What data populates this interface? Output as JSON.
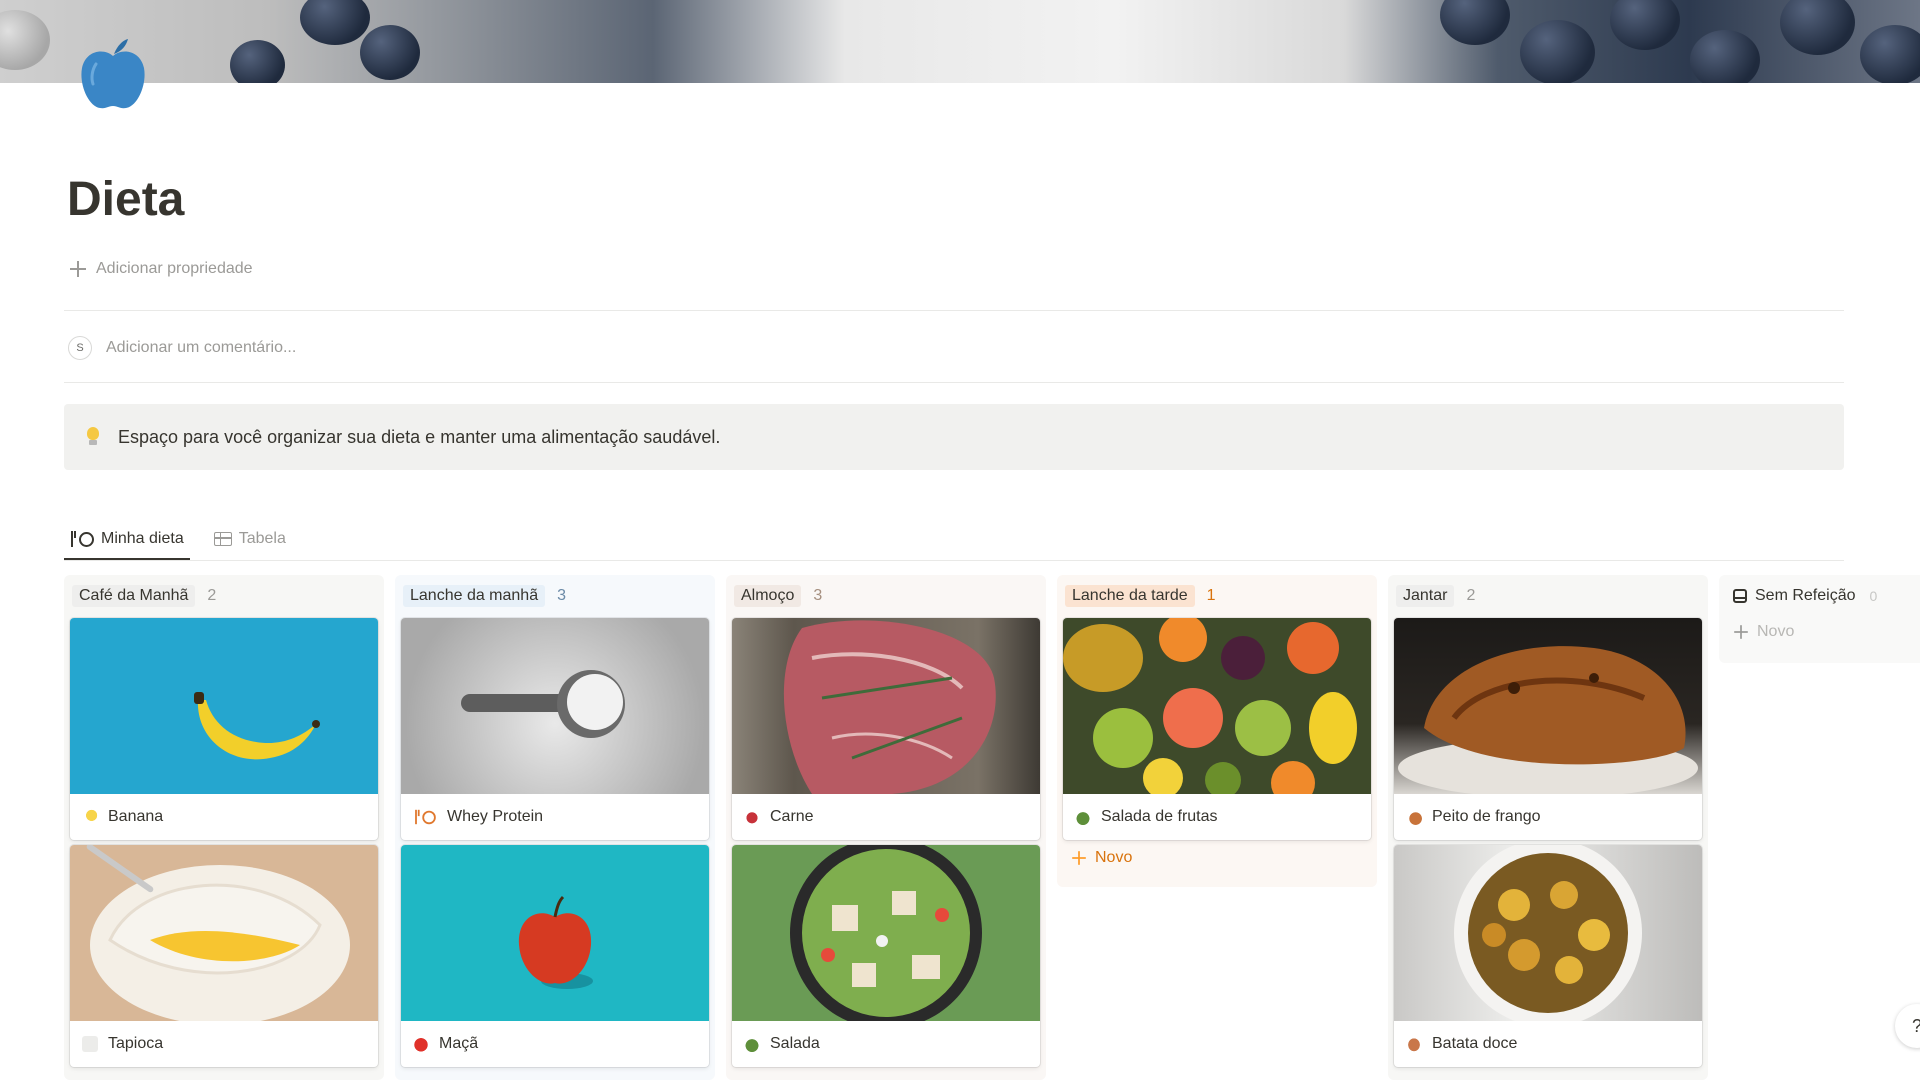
{
  "page": {
    "title": "Dieta",
    "add_property": "Adicionar propriedade",
    "comment": {
      "avatar": "S",
      "placeholder": "Adicionar um comentário..."
    },
    "callout": {
      "icon": "lightbulb-icon",
      "text": "Espaço para você organizar sua dieta e manter uma alimentação saudável."
    }
  },
  "tabs": [
    {
      "label": "Minha dieta",
      "icon": "cutlery-plate-icon",
      "active": true
    },
    {
      "label": "Tabela",
      "icon": "table-icon",
      "active": false
    }
  ],
  "columns": [
    {
      "name": "Café da Manhã",
      "count": "2",
      "pill_color": "#eeeeed",
      "bg": "#f7f7f5",
      "count_color": "#9b9a97",
      "cards": [
        {
          "title": "Banana",
          "icon": "banana-icon"
        },
        {
          "title": "Tapioca",
          "icon": "tapioca-icon"
        }
      ]
    },
    {
      "name": "Lanche da manhã",
      "count": "3",
      "pill_color": "#e7f0f8",
      "bg": "#f6f9fc",
      "count_color": "#6b8aa7",
      "cards": [
        {
          "title": "Whey Protein",
          "icon": "cutlery-plate-icon"
        },
        {
          "title": "Maçã",
          "icon": "apple-icon"
        }
      ]
    },
    {
      "name": "Almoço",
      "count": "3",
      "pill_color": "#f1e9e4",
      "bg": "#faf7f5",
      "count_color": "#a58f7f",
      "cards": [
        {
          "title": "Carne",
          "icon": "meat-icon"
        },
        {
          "title": "Salada",
          "icon": "salad-icon"
        }
      ]
    },
    {
      "name": "Lanche da tarde",
      "count": "1",
      "pill_color": "#fbe3d1",
      "bg": "#fcf7f3",
      "count_color": "#d9730d",
      "cards": [
        {
          "title": "Salada de frutas",
          "icon": "salad-icon"
        }
      ],
      "new_label": "Novo"
    },
    {
      "name": "Jantar",
      "count": "2",
      "pill_color": "#eeeeed",
      "bg": "#f7f7f5",
      "count_color": "#9b9a97",
      "cards": [
        {
          "title": "Peito de frango",
          "icon": "chicken-leg-icon"
        },
        {
          "title": "Batata doce",
          "icon": "sweet-potato-icon"
        }
      ]
    },
    {
      "name": "Sem Refeição",
      "count": "0",
      "icon": "inbox-icon",
      "bg": "#f9f9f8",
      "count_color": "#c7c7c5",
      "new_label": "Novo",
      "cards": []
    }
  ],
  "help": {
    "label": "?"
  }
}
